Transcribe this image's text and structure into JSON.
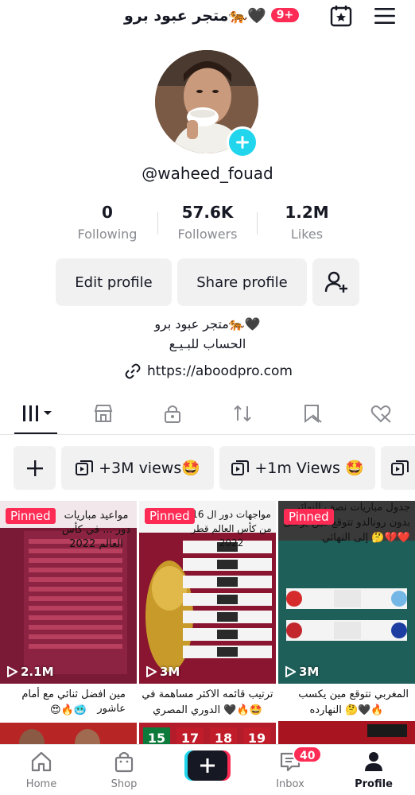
{
  "header": {
    "title": "متجر عبود برو🐅🖤",
    "notification_badge": "9+",
    "calendar_icon": "calendar-star-icon",
    "menu_icon": "hamburger-menu-icon"
  },
  "profile": {
    "username": "@waheed_fouad",
    "stats": [
      {
        "value": "0",
        "label": "Following"
      },
      {
        "value": "57.6K",
        "label": "Followers"
      },
      {
        "value": "1.2M",
        "label": "Likes"
      }
    ],
    "buttons": {
      "edit": "Edit profile",
      "share": "Share profile"
    },
    "bio_line1": "متجر عبود برو🐅🖤",
    "bio_line2": "الحساب للبـيـع",
    "link": "https://aboodpro.com"
  },
  "tabs": [
    "videos-grid",
    "shop",
    "private",
    "reposts",
    "favorites",
    "liked"
  ],
  "chips": {
    "add": "+",
    "items": [
      {
        "label": "+3M views🤩"
      },
      {
        "label": "+1m Views 🤩"
      }
    ]
  },
  "videos": [
    {
      "pinned": "Pinned",
      "views": "2.1M",
      "caption": "مواعيد مباريات دور ... في كأس العالم 2022"
    },
    {
      "pinned": "Pinned",
      "views": "3M",
      "caption": "مواجهات دور ال 16 من كأس العالم قطر 2022"
    },
    {
      "pinned": "Pinned",
      "views": "3M",
      "caption": "جدول مباريات نصف النهائي",
      "caption2": "بدون رونالدو تتوقع مين يوصل",
      "caption3": "إلى النهائي 🤔💔❤️"
    },
    {
      "caption": "مين افضل ثنائي مع أمام عاشور",
      "caption2": "😍🔥🥶"
    },
    {
      "caption": "ترتيب قائمه الاكثر مساهمة في",
      "caption2": "الدوري المصري 🖤🔥🤩",
      "numbers": [
        "15",
        "17",
        "18",
        "19"
      ]
    },
    {
      "caption": "المغربي تتوقع مين يكسب",
      "caption2": "النهارده 🤔🖤🔥"
    }
  ],
  "bottom_nav": {
    "home": "Home",
    "shop": "Shop",
    "inbox": "Inbox",
    "inbox_badge": "40",
    "profile": "Profile"
  },
  "colors": {
    "accent": "#fe2c55",
    "cyan": "#20d5ec",
    "text": "#161823",
    "muted": "#8a8b91",
    "button_bg": "#f1f1f2"
  }
}
